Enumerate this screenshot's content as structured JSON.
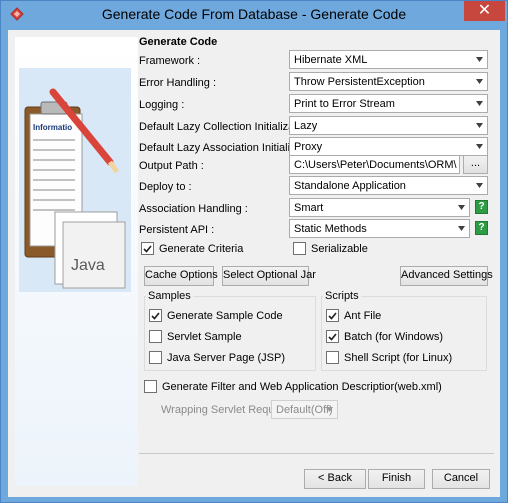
{
  "window": {
    "title": "Generate Code From Database - Generate Code",
    "close_label": "✕",
    "colors": {
      "frame": "#6fa8dc",
      "client": "#f0f0f0",
      "help": "#2e9b45",
      "close": "#c7463d"
    }
  },
  "illustration": {
    "java_text": "Java",
    "form_heading": "Informatio"
  },
  "form": {
    "heading": "Generate Code",
    "framework": {
      "label": "Framework :",
      "value": "Hibernate XML"
    },
    "error_handling": {
      "label": "Error Handling :",
      "value": "Throw PersistentException"
    },
    "logging": {
      "label": "Logging :",
      "value": "Print to Error Stream"
    },
    "lazy_collection": {
      "label": "Default Lazy Collection Initialization :",
      "value": "Lazy"
    },
    "lazy_association": {
      "label": "Default Lazy Association Initialization :",
      "value": "Proxy"
    },
    "output_path": {
      "label": "Output Path :",
      "value": "C:\\Users\\Peter\\Documents\\ORM\\",
      "browse_label": "..."
    },
    "deploy_to": {
      "label": "Deploy to :",
      "value": "Standalone Application"
    },
    "association_handling": {
      "label": "Association Handling :",
      "value": "Smart",
      "help": "?"
    },
    "persistent_api": {
      "label": "Persistent API :",
      "value": "Static Methods",
      "help": "?"
    },
    "generate_criteria": {
      "label": "Generate Criteria",
      "checked": true
    },
    "serializable": {
      "label": "Serializable",
      "checked": false
    }
  },
  "buttons": {
    "cache_options": "Cache Options",
    "select_optional_jar": "Select Optional Jar",
    "advanced_settings": "Advanced Settings",
    "back": "< Back",
    "finish": "Finish",
    "cancel": "Cancel"
  },
  "samples": {
    "title": "Samples",
    "items": [
      {
        "label": "Generate Sample Code",
        "checked": true
      },
      {
        "label": "Servlet Sample",
        "checked": false
      },
      {
        "label": "Java Server Page (JSP)",
        "checked": false
      }
    ]
  },
  "scripts": {
    "title": "Scripts",
    "items": [
      {
        "label": "Ant File",
        "checked": true
      },
      {
        "label": "Batch (for Windows)",
        "checked": true
      },
      {
        "label": "Shell Script (for Linux)",
        "checked": false
      }
    ]
  },
  "generate_filter": {
    "label": "Generate Filter and Web Application Descriptior(web.xml)",
    "checked": false
  },
  "wrapping": {
    "label": "Wrapping Servlet Request :",
    "value": "Default(Off)"
  }
}
